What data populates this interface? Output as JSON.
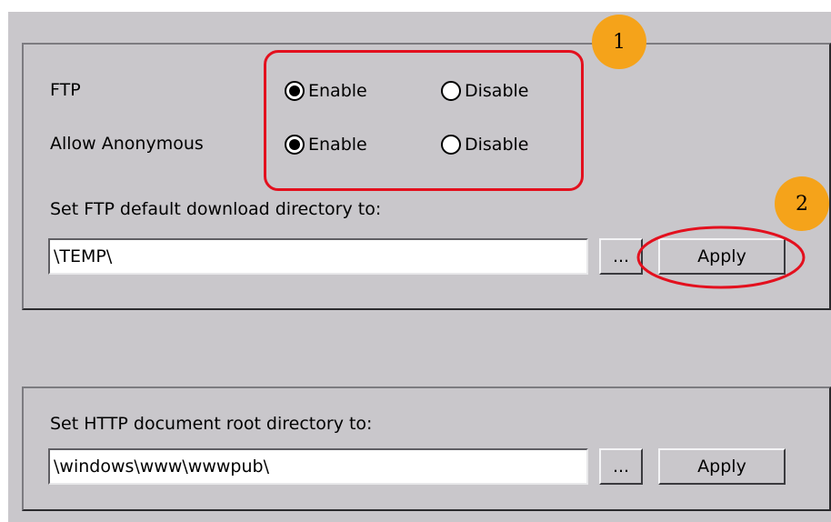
{
  "ftp_section": {
    "ftp_label": "FTP",
    "anonymous_label": "Allow Anonymous",
    "ftp_enable_label": "Enable",
    "ftp_disable_label": "Disable",
    "anon_enable_label": "Enable",
    "anon_disable_label": "Disable",
    "ftp_selected": "Enable",
    "anonymous_selected": "Enable",
    "directory_label": "Set FTP default download directory to:",
    "directory_value": "\\TEMP\\",
    "browse_label": "...",
    "apply_label": "Apply"
  },
  "http_section": {
    "directory_label": "Set HTTP document root directory to:",
    "directory_value": "\\windows\\www\\wwwpub\\",
    "browse_label": "...",
    "apply_label": "Apply"
  },
  "annotations": {
    "badge_1": "1",
    "badge_2": "2",
    "highlight_color": "#e3101e",
    "badge_color": "#f5a31a"
  }
}
